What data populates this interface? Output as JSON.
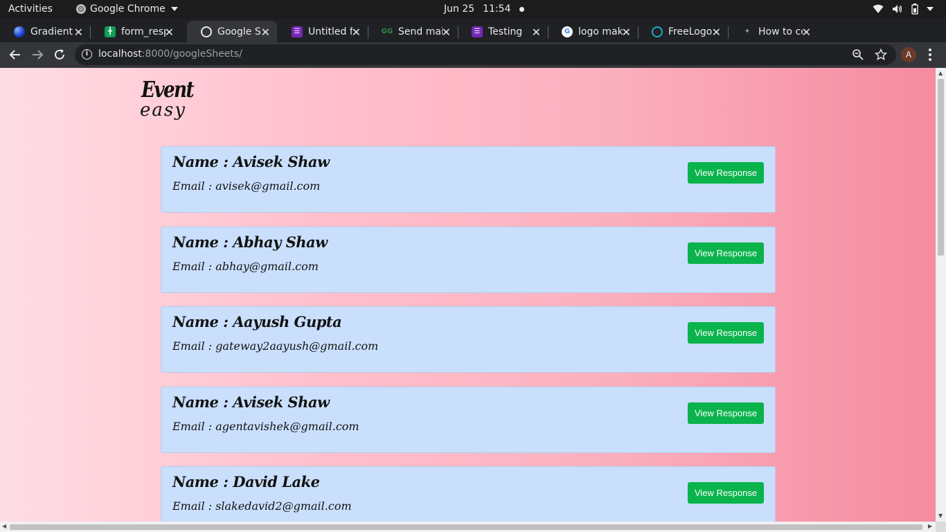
{
  "system_bar": {
    "activities": "Activities",
    "app_name": "Google Chrome",
    "date": "Jun 25",
    "time": "11:54"
  },
  "tabs": [
    {
      "title": "Gradient f",
      "icon": "gradient-favicon",
      "color": "#1a3fd1"
    },
    {
      "title": "form_resp",
      "icon": "sheets-favicon",
      "color": "#0f9d58"
    },
    {
      "title": "Google Sh",
      "icon": "globe-favicon",
      "color": "#8ab4f8",
      "active": true
    },
    {
      "title": "Untitled f",
      "icon": "forms-favicon",
      "color": "#7627bb"
    },
    {
      "title": "Send mail",
      "icon": "gfg-favicon",
      "color": "#2f8d46"
    },
    {
      "title": "Testing",
      "icon": "forms-favicon",
      "color": "#7627bb"
    },
    {
      "title": "logo make",
      "icon": "google-favicon",
      "color": "#4285f4"
    },
    {
      "title": "FreeLogo",
      "icon": "freelogo-favicon",
      "color": "#16b0c7"
    },
    {
      "title": "How to ce",
      "icon": "generic-favicon",
      "color": "#5f6368"
    }
  ],
  "omnibox": {
    "host": "localhost",
    "path": ":8000/googleSheets/"
  },
  "profile": {
    "initial": "A"
  },
  "logo": {
    "line1": "Event",
    "line2": "easy"
  },
  "responses": [
    {
      "name": "Name : Avisek Shaw",
      "email": "Email : avisek@gmail.com",
      "button": "View Response"
    },
    {
      "name": "Name : Abhay Shaw",
      "email": "Email : abhay@gmail.com",
      "button": "View Response"
    },
    {
      "name": "Name : Aayush Gupta",
      "email": "Email : gateway2aayush@gmail.com",
      "button": "View Response"
    },
    {
      "name": "Name : Avisek Shaw",
      "email": "Email : agentavishek@gmail.com",
      "button": "View Response"
    },
    {
      "name": "Name : David Lake",
      "email": "Email : slakedavid2@gmail.com",
      "button": "View Response"
    }
  ],
  "colors": {
    "button": "#0ab34b",
    "card": "#c9dffc",
    "gradient_start": "#ffdde4",
    "gradient_end": "#f58ba0"
  }
}
